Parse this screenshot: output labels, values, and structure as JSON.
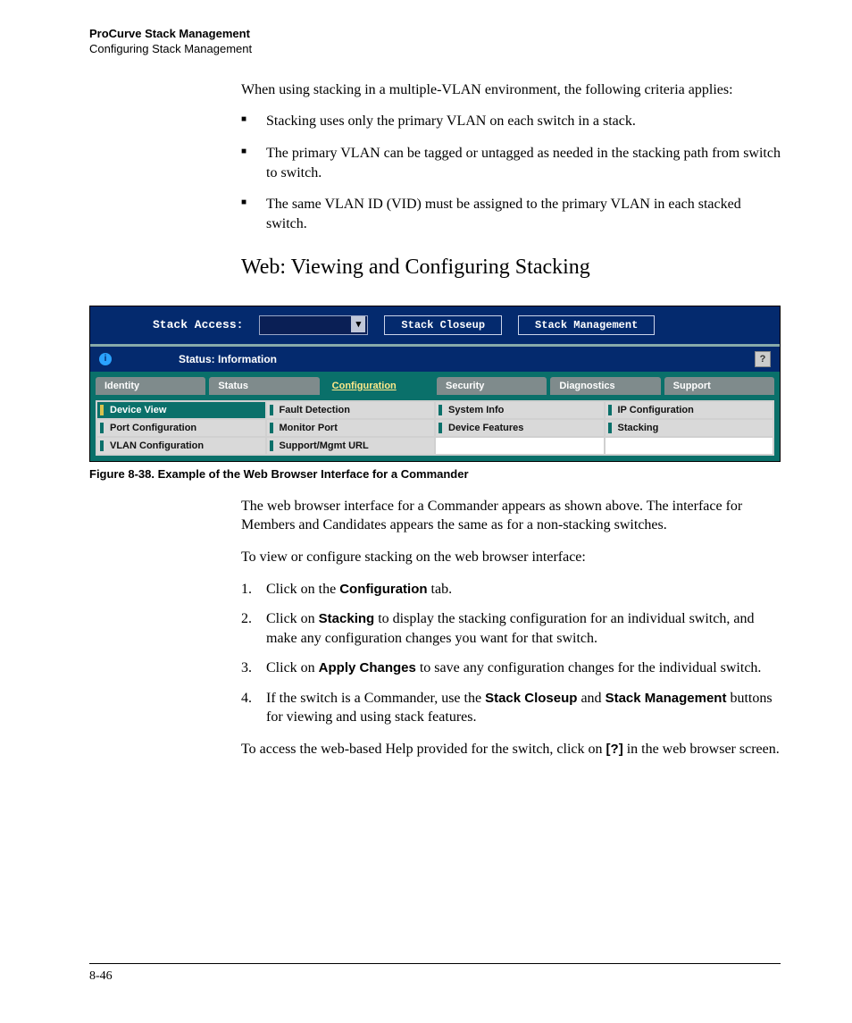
{
  "header": {
    "title": "ProCurve Stack Management",
    "subtitle": "Configuring Stack Management"
  },
  "intro": "When using stacking in a multiple-VLAN environment, the following criteria applies:",
  "bullets": [
    "Stacking uses only the primary VLAN on each switch in a stack.",
    "The primary VLAN can be tagged or untagged as needed in the stacking path from switch to switch.",
    "The same VLAN ID (VID) must be assigned to the primary VLAN in each stacked switch."
  ],
  "section_heading": "Web: Viewing and Configuring Stacking",
  "screenshot": {
    "stack_access_label": "Stack Access:",
    "btn_closeup": "Stack Closeup",
    "btn_mgmt": "Stack Management",
    "status_label": "Status:",
    "status_value": "Information",
    "tabs": [
      "Identity",
      "Status",
      "Configuration",
      "Security",
      "Diagnostics",
      "Support"
    ],
    "active_tab_index": 2,
    "sub_items": [
      "Device View",
      "Fault Detection",
      "System Info",
      "IP Configuration",
      "Port Configuration",
      "Monitor Port",
      "Device Features",
      "Stacking",
      "VLAN Configuration",
      "Support/Mgmt URL",
      "",
      ""
    ],
    "active_sub_index": 0
  },
  "figure_caption": "Figure 8-38.  Example of the Web Browser Interface for a Commander",
  "after_fig_para": "The web browser interface for a Commander appears as shown above. The interface for Members and Candidates appears the same as for a non-stacking switches.",
  "steps_intro": "To view or configure stacking on the web browser interface:",
  "steps": [
    {
      "pre": "Click on the ",
      "bold": "Configuration",
      "post": " tab."
    },
    {
      "pre": "Click on ",
      "bold": "Stacking",
      "post": " to display the stacking configuration for an individual switch, and make any configuration changes you want for that switch."
    },
    {
      "pre": "Click on ",
      "bold": "Apply Changes",
      "post": " to save any configuration changes for the individual switch."
    },
    {
      "pre": "If the switch is a Commander, use the ",
      "bold": "Stack Closeup",
      "mid": " and ",
      "bold2": "Stack Management",
      "post": " buttons for viewing and using stack features."
    }
  ],
  "closing_pre": "To access the web-based Help provided for the switch, click on ",
  "closing_bold": "[?]",
  "closing_post": " in the web browser screen.",
  "page_number": "8-46"
}
